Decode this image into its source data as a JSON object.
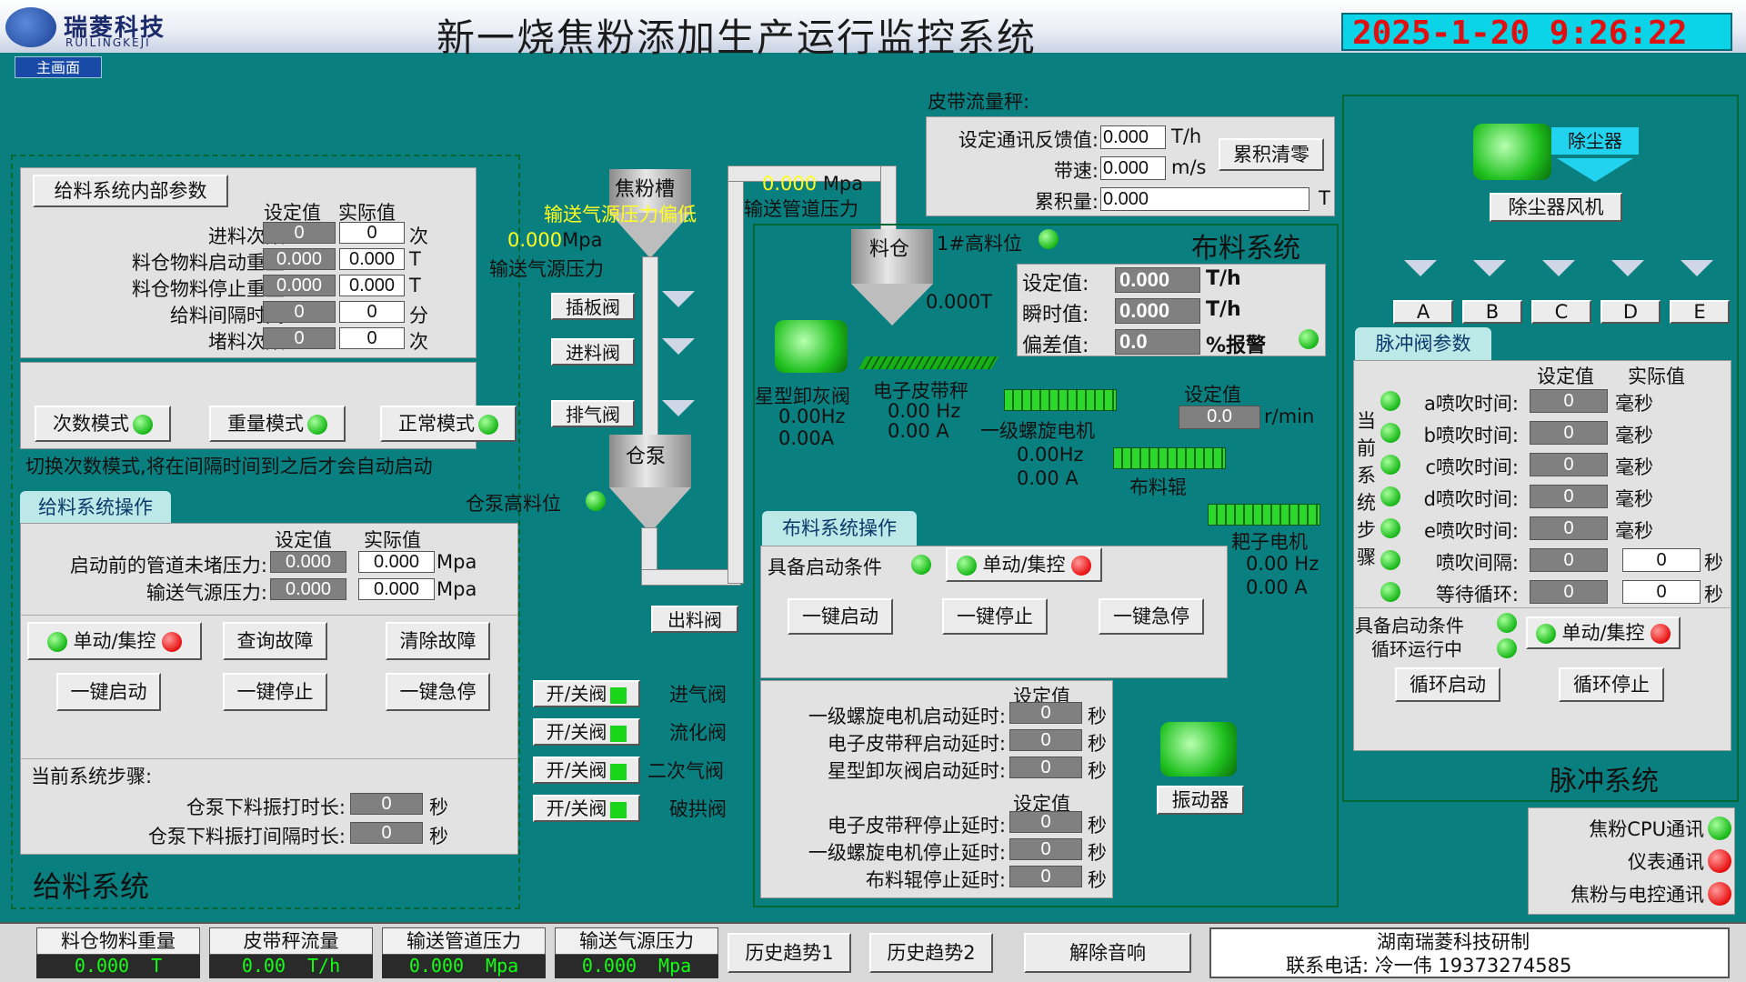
{
  "header": {
    "logo_cn": "瑞菱科技",
    "logo_en": "RUILINGKEJI",
    "title": "新一烧焦粉添加生产运行监控系统",
    "datetime": "2025-1-20 9:26:22",
    "main_btn": "主画面"
  },
  "feed_params": {
    "title": "给料系统内部参数",
    "col_set": "设定值",
    "col_act": "实际值",
    "rows": [
      {
        "label": "进料次数:",
        "set": "0",
        "act": "0",
        "unit": "次"
      },
      {
        "label": "料仓物料启动重量:",
        "set": "0.000",
        "act": "0.000",
        "unit": "T"
      },
      {
        "label": "料仓物料停止重量:",
        "set": "0.000",
        "act": "0.000",
        "unit": "T"
      },
      {
        "label": "给料间隔时间:",
        "set": "0",
        "act": "0",
        "unit": "分"
      },
      {
        "label": "堵料次数:",
        "set": "0",
        "act": "0",
        "unit": "次"
      }
    ],
    "modes": [
      "次数模式",
      "重量模式",
      "正常模式"
    ],
    "hint": "切换次数模式,将在间隔时间到之后才会自动启动"
  },
  "feed_ops": {
    "title": "给料系统操作",
    "col_set": "设定值",
    "col_act": "实际值",
    "rows": [
      {
        "label": "启动前的管道未堵压力:",
        "set": "0.000",
        "act": "0.000",
        "unit": "Mpa"
      },
      {
        "label": "输送气源压力:",
        "set": "0.000",
        "act": "0.000",
        "unit": "Mpa"
      }
    ],
    "btn_mode": "单动/集控",
    "btn_query": "查询故障",
    "btn_clear": "清除故障",
    "btn_start": "一键启动",
    "btn_stop": "一键停止",
    "btn_estop": "一键急停",
    "step_label": "当前系统步骤:",
    "vib_rows": [
      {
        "label": "仓泵下料振打时长:",
        "val": "0",
        "unit": "秒"
      },
      {
        "label": "仓泵下料振打间隔时长:",
        "val": "0",
        "unit": "秒"
      }
    ],
    "system_name": "给料系统"
  },
  "process": {
    "coke_tank": "焦粉槽",
    "gas_low": "输送气源压力偏低",
    "gas_val": "0.000",
    "gas_unit": "Mpa",
    "gas_label": "输送气源压力",
    "plug_valve": "插板阀",
    "inlet_valve": "进料阀",
    "exhaust_valve": "排气阀",
    "pump": "仓泵",
    "pump_high": "仓泵高料位",
    "outlet_valve": "出料阀",
    "pipe_val": "0.000",
    "pipe_unit": "Mpa",
    "pipe_label": "输送管道压力",
    "valves": [
      {
        "btn": "开/关阀",
        "name": "进气阀"
      },
      {
        "btn": "开/关阀",
        "name": "流化阀"
      },
      {
        "btn": "开/关阀",
        "name": "二次气阀"
      },
      {
        "btn": "开/关阀",
        "name": "破拱阀"
      }
    ]
  },
  "belt": {
    "title": "皮带流量秤:",
    "rows": [
      {
        "label": "设定通讯反馈值:",
        "val": "0.000",
        "unit": "T/h"
      },
      {
        "label": "带速:",
        "val": "0.000",
        "unit": "m/s"
      },
      {
        "label": "累积量:",
        "val": "0.000",
        "unit": "T"
      }
    ],
    "clear_btn": "累积清零"
  },
  "cloth": {
    "bin": "料仓",
    "high_level": "1#高料位",
    "system_name": "布料系统",
    "bin_weight": "0.000T",
    "rows": [
      {
        "label": "设定值:",
        "val": "0.000",
        "unit": "T/h"
      },
      {
        "label": "瞬时值:",
        "val": "0.000",
        "unit": "T/h"
      },
      {
        "label": "偏差值:",
        "val": "0.0",
        "unit": "%报警"
      }
    ],
    "star_valve": "星型卸灰阀",
    "star_hz": "0.00Hz",
    "star_a": "0.00A",
    "belt_scale": "电子皮带秤",
    "belt_hz": "0.00 Hz",
    "belt_a": "0.00 A",
    "screw": "一级螺旋电机",
    "screw_hz": "0.00Hz",
    "screw_a": "0.00 A",
    "set_label": "设定值",
    "set_val": "0.0",
    "set_unit": "r/min",
    "roller": "布料辊",
    "harrow": "耙子电机",
    "harrow_hz": "0.00 Hz",
    "harrow_a": "0.00 A",
    "ops_title": "布料系统操作",
    "cond": "具备启动条件",
    "btn_mode": "单动/集控",
    "btn_start": "一键启动",
    "btn_stop": "一键停止",
    "btn_estop": "一键急停",
    "start_delays": {
      "header": "设定值",
      "rows": [
        {
          "label": "一级螺旋电机启动延时:",
          "val": "0",
          "unit": "秒"
        },
        {
          "label": "电子皮带秤启动延时:",
          "val": "0",
          "unit": "秒"
        },
        {
          "label": "星型卸灰阀启动延时:",
          "val": "0",
          "unit": "秒"
        }
      ]
    },
    "stop_delays": {
      "header": "设定值",
      "rows": [
        {
          "label": "电子皮带秤停止延时:",
          "val": "0",
          "unit": "秒"
        },
        {
          "label": "一级螺旋电机停止延时:",
          "val": "0",
          "unit": "秒"
        },
        {
          "label": "布料辊停止延时:",
          "val": "0",
          "unit": "秒"
        }
      ]
    },
    "vibrator": "振动器"
  },
  "pulse": {
    "dust": "除尘器",
    "fan": "除尘器风机",
    "valves": [
      "A",
      "B",
      "C",
      "D",
      "E"
    ],
    "title": "脉冲阀参数",
    "col_set": "设定值",
    "col_act": "实际值",
    "side": "当前系统步骤",
    "rows": [
      {
        "label": "a喷吹时间:",
        "set": "0",
        "act": "",
        "unit": "毫秒"
      },
      {
        "label": "b喷吹时间:",
        "set": "0",
        "act": "",
        "unit": "毫秒"
      },
      {
        "label": "c喷吹时间:",
        "set": "0",
        "act": "",
        "unit": "毫秒"
      },
      {
        "label": "d喷吹时间:",
        "set": "0",
        "act": "",
        "unit": "毫秒"
      },
      {
        "label": "e喷吹时间:",
        "set": "0",
        "act": "",
        "unit": "毫秒"
      },
      {
        "label": "喷吹间隔:",
        "set": "0",
        "act": "0",
        "unit": "秒"
      },
      {
        "label": "等待循环:",
        "set": "0",
        "act": "0",
        "unit": "秒"
      }
    ],
    "cond": "具备启动条件",
    "running": "循环运行中",
    "btn_mode": "单动/集控",
    "btn_start": "循环启动",
    "btn_stop": "循环停止",
    "system_name": "脉冲系统"
  },
  "comm": [
    {
      "label": "焦粉CPU通讯",
      "status": "ok"
    },
    {
      "label": "仪表通讯",
      "status": "err"
    },
    {
      "label": "焦粉与电控通讯",
      "status": "err"
    }
  ],
  "bottom": {
    "cells": [
      {
        "label": "料仓物料重量",
        "val": "0.000",
        "unit": "T"
      },
      {
        "label": "皮带秤流量",
        "val": "0.00",
        "unit": "T/h"
      },
      {
        "label": "输送管道压力",
        "val": "0.000",
        "unit": "Mpa"
      },
      {
        "label": "输送气源压力",
        "val": "0.000",
        "unit": "Mpa"
      }
    ],
    "hist1": "历史趋势1",
    "hist2": "历史趋势2",
    "mute": "解除音响",
    "company": "湖南瑞菱科技研制",
    "contact": "联系电话:    冷一伟 19373274585"
  }
}
